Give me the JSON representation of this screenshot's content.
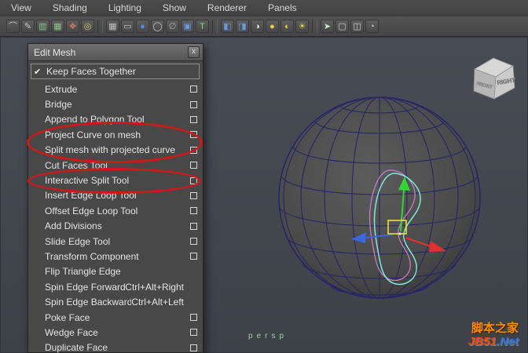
{
  "menubar": {
    "items": [
      "View",
      "Shading",
      "Lighting",
      "Show",
      "Renderer",
      "Panels"
    ]
  },
  "toolbar": {
    "icons": [
      {
        "name": "lasso-select-icon",
        "glyph": "⌒",
        "color": "#c8c8c8"
      },
      {
        "name": "paint-select-icon",
        "glyph": "✎",
        "color": "#c8c8c8"
      },
      {
        "name": "graph-editor-icon",
        "glyph": "▥",
        "color": "#86c886"
      },
      {
        "name": "grid-snap-icon",
        "glyph": "▦",
        "color": "#86c886"
      },
      {
        "name": "camera-settings-icon",
        "glyph": "❖",
        "color": "#c87a6a"
      },
      {
        "name": "bookmark-icon",
        "glyph": "◎",
        "color": "#d8c86a"
      },
      {
        "sep": true
      },
      {
        "name": "grid-icon",
        "glyph": "▦",
        "color": "#c0c0c0"
      },
      {
        "name": "film-gate-icon",
        "glyph": "▭",
        "color": "#c0c0c0"
      },
      {
        "name": "shaded-display-icon",
        "glyph": "●",
        "color": "#5588dd"
      },
      {
        "name": "wireframe-display-icon",
        "glyph": "◯",
        "color": "#c0c0c0"
      },
      {
        "name": "field-chart-icon",
        "glyph": "∅",
        "color": "#a8a8a8"
      },
      {
        "name": "safe-title-icon",
        "glyph": "▣",
        "color": "#6699dd"
      },
      {
        "name": "textured-display-icon",
        "glyph": "T",
        "color": "#7ed87e"
      },
      {
        "sep": true
      },
      {
        "name": "use-default-material-icon",
        "glyph": "◧",
        "color": "#6699dd"
      },
      {
        "name": "smooth-shade-icon",
        "glyph": "◨",
        "color": "#6699dd"
      },
      {
        "name": "checker-material-icon",
        "glyph": "◑",
        "color": "#e8e8e8"
      },
      {
        "name": "lighting-icon",
        "glyph": "●",
        "color": "#e8d44a"
      },
      {
        "name": "shadows-icon",
        "glyph": "◐",
        "color": "#e8d44a"
      },
      {
        "name": "occlusion-light-icon",
        "glyph": "☀",
        "color": "#e8d44a"
      },
      {
        "sep": true
      },
      {
        "name": "isolate-select-icon",
        "glyph": "➤",
        "color": "#c8e8c8"
      },
      {
        "name": "xray-cube-icon",
        "glyph": "▢",
        "color": "#d0d0d0"
      },
      {
        "name": "xray-joints-icon",
        "glyph": "◫",
        "color": "#d0d0d0"
      },
      {
        "name": "exposure-icon",
        "glyph": "◔",
        "color": "#d0d0d0"
      }
    ]
  },
  "edit_mesh_menu": {
    "title": "Edit Mesh",
    "close_label": "x",
    "items": [
      {
        "label": "Keep Faces Together",
        "checked": true,
        "boxed": true
      },
      {
        "label": "Extrude",
        "option_box": true
      },
      {
        "label": "Bridge",
        "option_box": true
      },
      {
        "label": "Append to Polygon Tool",
        "option_box": true
      },
      {
        "label": "Project Curve on mesh",
        "option_box": true,
        "annotated": true
      },
      {
        "label": "Split mesh with projected curve",
        "option_box": true,
        "annotated": true
      },
      {
        "label": "Cut Faces Tool",
        "option_box": true
      },
      {
        "label": "Interactive Split Tool",
        "option_box": true,
        "annotated": true
      },
      {
        "label": "Insert Edge Loop Tool",
        "option_box": true
      },
      {
        "label": "Offset Edge Loop Tool",
        "option_box": true
      },
      {
        "label": "Add Divisions",
        "option_box": true
      },
      {
        "label": "Slide Edge Tool",
        "option_box": true
      },
      {
        "label": "Transform Component",
        "option_box": true
      },
      {
        "label": "Flip Triangle Edge"
      },
      {
        "label": "Spin Edge Forward",
        "shortcut": "Ctrl+Alt+Right"
      },
      {
        "label": "Spin Edge Backward",
        "shortcut": "Ctrl+Alt+Left"
      },
      {
        "label": "Poke Face",
        "option_box": true
      },
      {
        "label": "Wedge Face",
        "option_box": true
      },
      {
        "label": "Duplicate Face",
        "option_box": true
      }
    ]
  },
  "viewport": {
    "camera_label": "persp",
    "view_cube": {
      "right_face": "RIGHT",
      "front_face": "FRONT"
    },
    "watermark": {
      "line1": "脚本之家",
      "brand": "JB51",
      "suffix": ".Net"
    }
  },
  "colors": {
    "annotation_red": "#d01818",
    "manipulator_green": "#35d435",
    "manipulator_red": "#e23030",
    "manipulator_blue": "#3a66e0",
    "selection_yellow": "#e6e62e",
    "curve_cyan": "#7fe8d8",
    "curve_magenta": "#cc7fcc",
    "wireframe_blue": "#262668",
    "watermark_orange": "#ff8c00"
  }
}
